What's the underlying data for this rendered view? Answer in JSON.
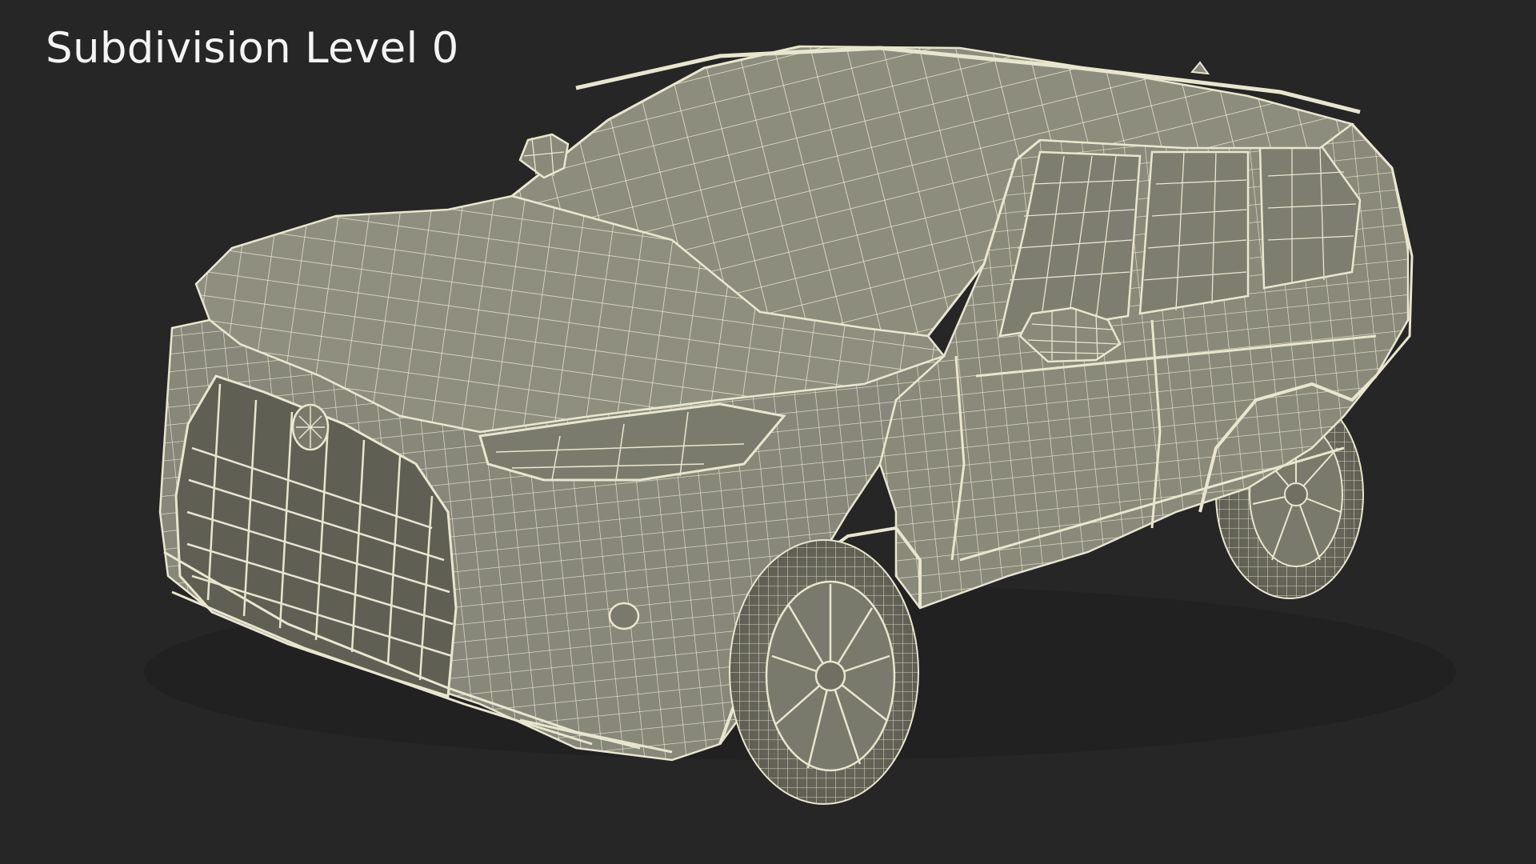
{
  "title": "Subdivision Level 0",
  "colors": {
    "background": "#262626",
    "body_fill": "#8a8a7a",
    "body_fill_dark": "#6f6f62",
    "wire": "#e9e6cf",
    "title_text": "#f4f4f4"
  },
  "subject": {
    "kind": "vehicle-wireframe",
    "body_style": "suv",
    "view": "front-three-quarter-left"
  }
}
